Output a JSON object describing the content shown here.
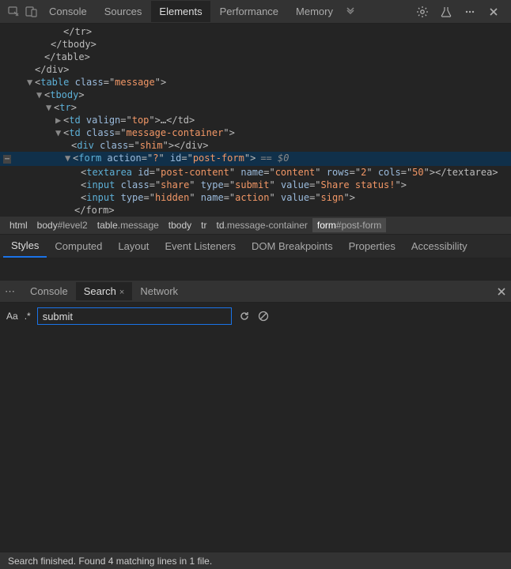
{
  "topTabs": {
    "console": "Console",
    "sources": "Sources",
    "elements": "Elements",
    "performance": "Performance",
    "memory": "Memory"
  },
  "dom": {
    "l1": "</tr>",
    "l2": "</tbody>",
    "l3": "</table>",
    "l4": "</div>",
    "tableOpen": {
      "tag": "table",
      "attr": "class",
      "val": "message"
    },
    "tbody": "tbody",
    "tr": "tr",
    "td1": {
      "tag": "td",
      "attr": "valign",
      "val": "top",
      "inner": "…",
      "close": "</td>"
    },
    "td2": {
      "tag": "td",
      "attr": "class",
      "val": "message-container"
    },
    "divShim": {
      "tag": "div",
      "attr": "class",
      "val": "shim",
      "close": "</div>"
    },
    "form": {
      "tag": "form",
      "attr1": "action",
      "val1": "?",
      "attr2": "id",
      "val2": "post-form",
      "marker": "== $0"
    },
    "textarea": {
      "tag": "textarea",
      "id": "post-content",
      "name": "content",
      "rows": "2",
      "cols": "50",
      "close": "</textarea>"
    },
    "input1": {
      "tag": "input",
      "class": "share",
      "type": "submit",
      "value": "Share status!"
    },
    "input2": {
      "tag": "input",
      "type": "hidden",
      "name": "action",
      "value": "sign"
    },
    "formClose": "</form>"
  },
  "breadcrumb": {
    "html": "html",
    "body": "body",
    "bodyId": "#level2",
    "table": "table",
    "tableCls": ".message",
    "tbody": "tbody",
    "tr": "tr",
    "td": "td",
    "tdCls": ".message-container",
    "form": "form",
    "formId": "#post-form"
  },
  "stylesTabs": {
    "styles": "Styles",
    "computed": "Computed",
    "layout": "Layout",
    "eventListeners": "Event Listeners",
    "domBreakpoints": "DOM Breakpoints",
    "properties": "Properties",
    "accessibility": "Accessibility"
  },
  "drawerTabs": {
    "console": "Console",
    "search": "Search",
    "network": "Network"
  },
  "searchBar": {
    "aa": "Aa",
    "regex": ".*",
    "value": "submit"
  },
  "status": "Search finished.  Found 4 matching lines in 1 file."
}
